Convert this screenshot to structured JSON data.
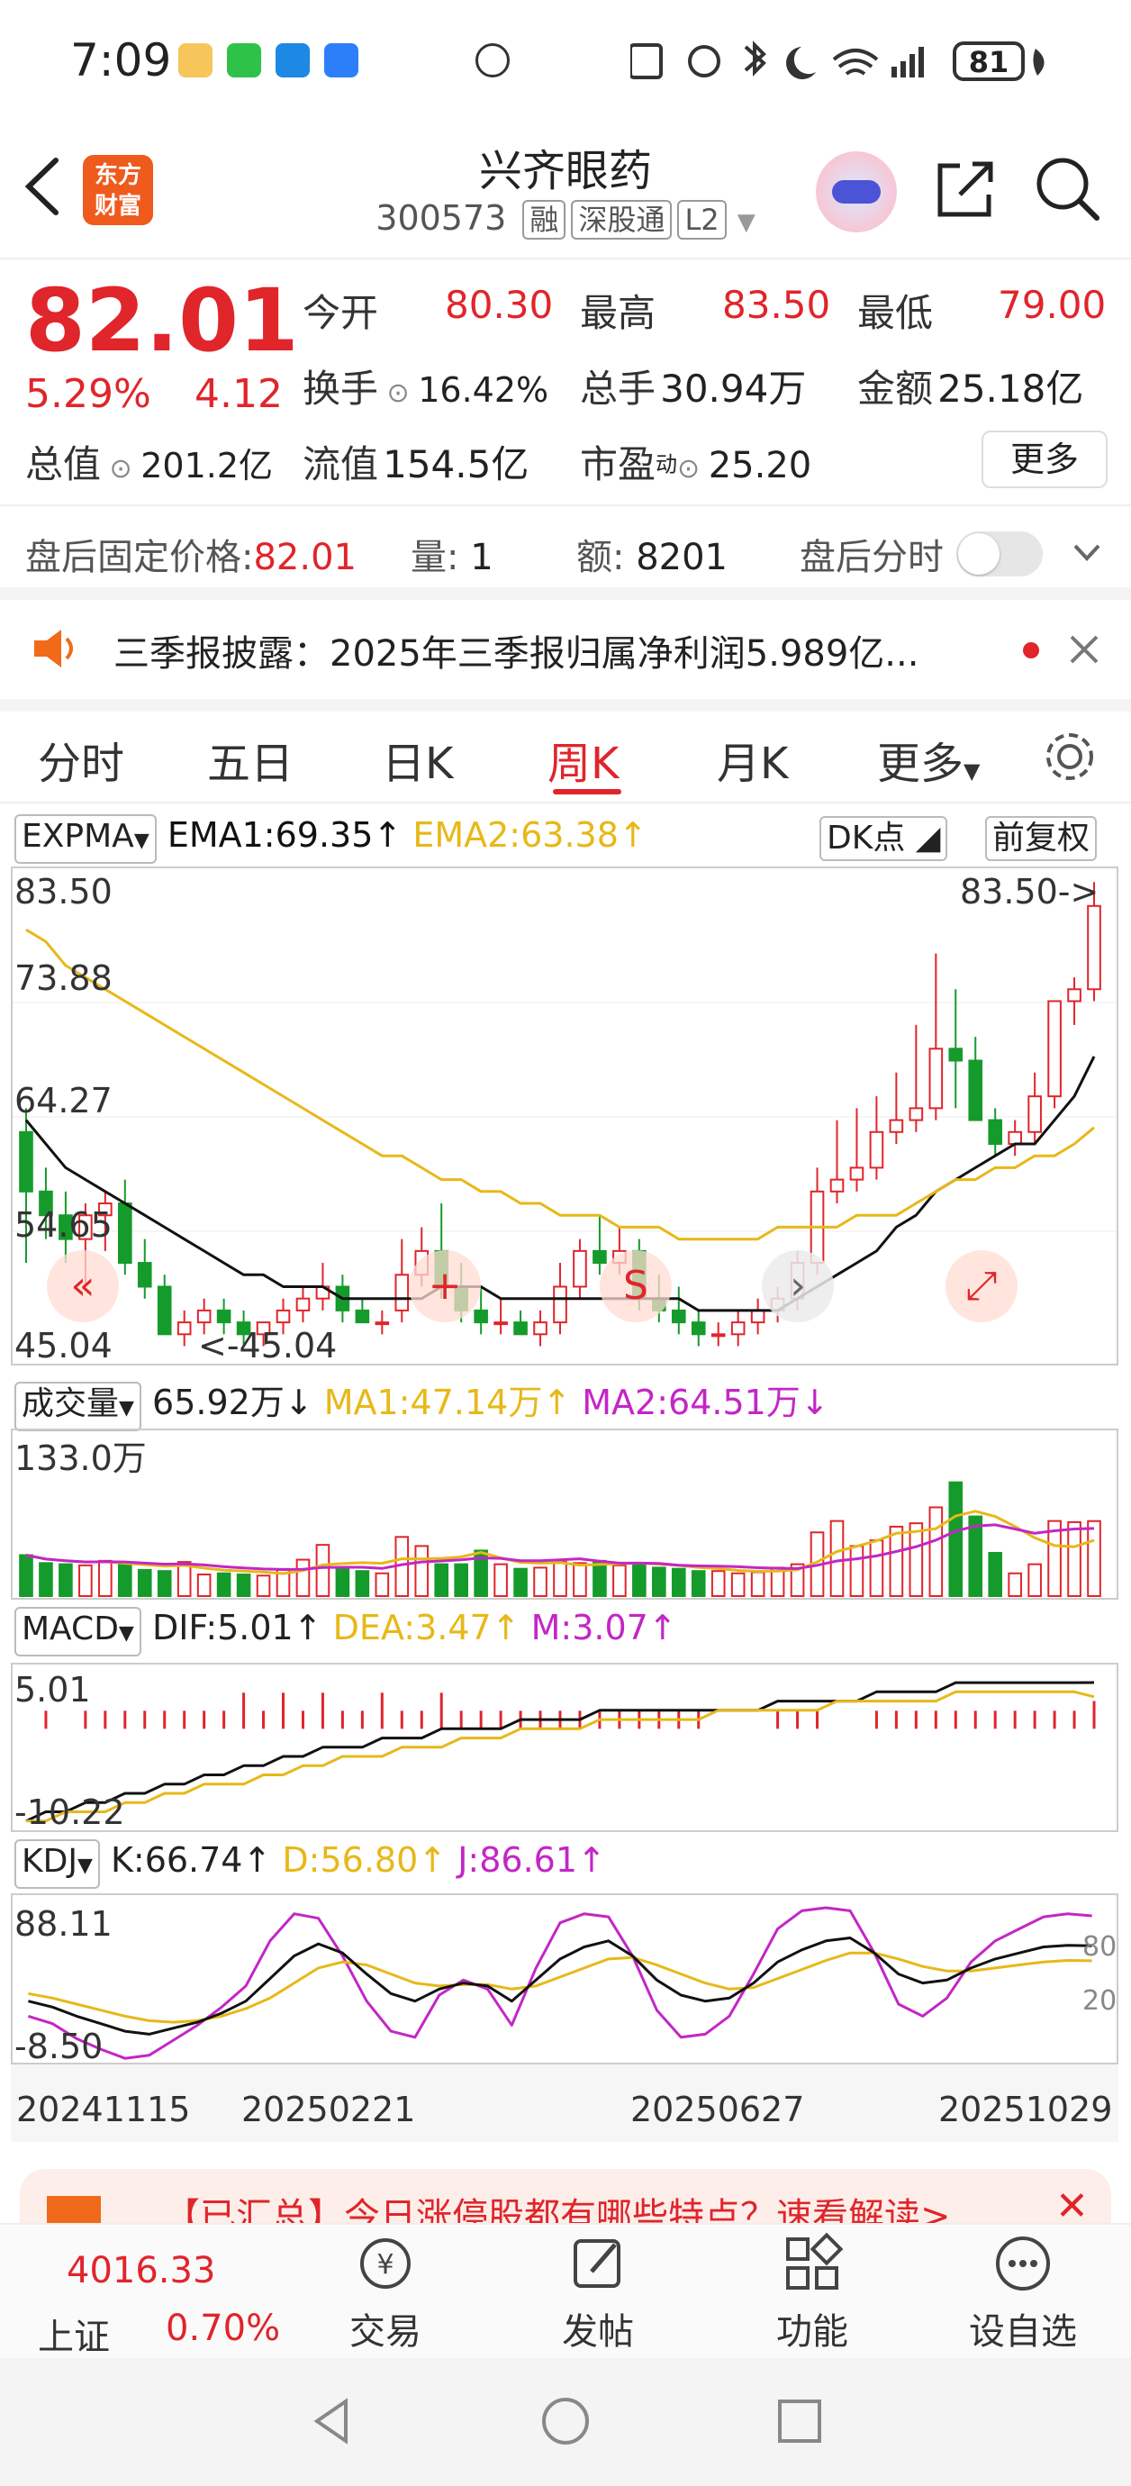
{
  "status_bar": {
    "time": "7:09",
    "battery": "81"
  },
  "header": {
    "logo_line1": "东方",
    "logo_line2": "财富",
    "stock_name": "兴齐眼药",
    "stock_code": "300573",
    "tags": [
      "融",
      "深股通",
      "L2"
    ]
  },
  "quote": {
    "price": "82.01",
    "change_pct": "5.29%",
    "change": "4.12",
    "open_label": "今开",
    "open": "80.30",
    "high_label": "最高",
    "high": "83.50",
    "low_label": "最低",
    "low": "79.00",
    "turnover_label": "换手",
    "turnover": "16.42%",
    "volume_label": "总手",
    "volume": "30.94万",
    "amount_label": "金额",
    "amount": "25.18亿",
    "mktcap_label": "总值",
    "mktcap": "201.2亿",
    "float_label": "流值",
    "float_cap": "154.5亿",
    "pe_label": "市盈",
    "pe_sup": "动",
    "pe": "25.20",
    "more_label": "更多"
  },
  "after_hours": {
    "price_label": "盘后固定价格:",
    "price": "82.01",
    "vol_label": "量:",
    "vol": "1",
    "amt_label": "额:",
    "amt": "8201",
    "toggle_label": "盘后分时"
  },
  "notice": {
    "text": "三季报披露：2025年三季报归属净利润5.989亿..."
  },
  "tabs": [
    {
      "label": "分时"
    },
    {
      "label": "五日"
    },
    {
      "label": "日K"
    },
    {
      "label": "周K"
    },
    {
      "label": "月K"
    },
    {
      "label": "更多"
    }
  ],
  "kline": {
    "indicator": "EXPMA",
    "ema1": "EMA1:69.35",
    "ema2": "EMA2:63.38",
    "dk_label": "DK点",
    "adjust_label": "前复权",
    "y_labels": [
      "83.50",
      "73.88",
      "64.27",
      "54.65",
      "45.04"
    ],
    "max_label": "83.50->",
    "min_label": "<-45.04"
  },
  "volume": {
    "indicator": "成交量",
    "val": "65.92万",
    "ma1": "MA1:47.14万",
    "ma2": "MA2:64.51万",
    "y_top": "133.0万"
  },
  "macd": {
    "indicator": "MACD",
    "dif": "DIF:5.01",
    "dea": "DEA:3.47",
    "m": "M:3.07",
    "y_top": "5.01",
    "y_bottom": "-10.22"
  },
  "kdj": {
    "indicator": "KDJ",
    "k": "K:66.74",
    "d": "D:56.80",
    "j": "J:86.61",
    "y_top": "88.11",
    "y_bottom": "-8.50",
    "lvl80": "80",
    "lvl20": "20"
  },
  "dates": [
    "20241115",
    "20250221",
    "20250627",
    "20251029"
  ],
  "promo": {
    "text": "【已汇总】今日涨停股都有哪些特点？速看解读>"
  },
  "bottom": {
    "index_value": "4016.33",
    "index_name": "上证",
    "index_change": "0.70%",
    "items": [
      {
        "label": "交易"
      },
      {
        "label": "发帖"
      },
      {
        "label": "功能"
      },
      {
        "label": "设自选"
      }
    ]
  },
  "colors": {
    "up": "#e0252b",
    "down": "#159b2b",
    "ema1": "#111111",
    "ema2": "#e7b818",
    "ma2": "#c326c6"
  },
  "chart_data": {
    "type": "candlestick",
    "period": "weekly",
    "x_labels": [
      "20241115",
      "20250221",
      "20250627",
      "20251029"
    ],
    "ylim": [
      45.04,
      83.5
    ],
    "ohlc": [
      [
        63,
        65,
        52,
        58
      ],
      [
        58,
        60,
        54,
        56
      ],
      [
        56,
        58,
        52,
        54
      ],
      [
        54,
        57,
        50,
        56
      ],
      [
        56,
        58,
        53,
        57
      ],
      [
        57,
        59,
        51,
        52
      ],
      [
        52,
        54,
        49,
        50
      ],
      [
        50,
        51,
        46,
        46
      ],
      [
        46,
        48,
        45,
        47
      ],
      [
        47,
        49,
        46,
        48
      ],
      [
        48,
        49,
        46,
        47
      ],
      [
        47,
        48,
        45,
        46
      ],
      [
        46,
        47,
        45,
        47
      ],
      [
        47,
        49,
        46,
        48
      ],
      [
        48,
        50,
        47,
        49
      ],
      [
        49,
        52,
        48,
        50
      ],
      [
        50,
        51,
        47,
        48
      ],
      [
        48,
        49,
        47,
        47
      ],
      [
        47,
        48,
        46,
        47
      ],
      [
        48,
        54,
        47,
        51
      ],
      [
        51,
        55,
        50,
        53
      ],
      [
        53,
        57,
        49,
        50
      ],
      [
        50,
        52,
        47,
        48
      ],
      [
        48,
        50,
        46,
        47
      ],
      [
        47,
        49,
        46,
        47
      ],
      [
        47,
        48,
        46,
        46
      ],
      [
        46,
        48,
        45,
        47
      ],
      [
        47,
        52,
        46,
        50
      ],
      [
        50,
        54,
        49,
        53
      ],
      [
        53,
        56,
        51,
        52
      ],
      [
        52,
        55,
        51,
        53
      ],
      [
        53,
        54,
        48,
        49
      ],
      [
        49,
        51,
        47,
        48
      ],
      [
        48,
        50,
        46,
        47
      ],
      [
        47,
        48,
        45,
        46
      ],
      [
        46,
        47,
        45,
        46
      ],
      [
        46,
        48,
        45,
        47
      ],
      [
        47,
        49,
        46,
        48
      ],
      [
        48,
        50,
        47,
        49
      ],
      [
        49,
        53,
        48,
        52
      ],
      [
        52,
        60,
        51,
        58
      ],
      [
        58,
        64,
        57,
        59
      ],
      [
        59,
        65,
        58,
        60
      ],
      [
        60,
        66,
        59,
        63
      ],
      [
        63,
        68,
        62,
        64
      ],
      [
        64,
        72,
        63,
        65
      ],
      [
        65,
        78,
        64,
        70
      ],
      [
        70,
        75,
        65,
        69
      ],
      [
        69,
        71,
        64,
        64
      ],
      [
        64,
        65,
        61,
        62
      ],
      [
        62,
        64,
        61,
        63
      ],
      [
        63,
        68,
        62,
        66
      ],
      [
        66,
        74,
        65,
        74
      ],
      [
        74,
        76,
        72,
        75
      ],
      [
        75,
        84,
        74,
        82
      ]
    ],
    "ema1": [
      64,
      62,
      60,
      59,
      58,
      57,
      56,
      55,
      54,
      53,
      52,
      51,
      51,
      50,
      50,
      50,
      49,
      49,
      49,
      49,
      49,
      50,
      50,
      50,
      49,
      49,
      49,
      49,
      49,
      49,
      49,
      49,
      49,
      49,
      48,
      48,
      48,
      48,
      48,
      49,
      50,
      51,
      52,
      53,
      55,
      56,
      58,
      59,
      60,
      61,
      62,
      62,
      64,
      66,
      69.35
    ],
    "ema2": [
      80,
      79,
      77,
      76,
      75,
      74,
      73,
      72,
      71,
      70,
      69,
      68,
      67,
      66,
      65,
      64,
      63,
      62,
      61,
      61,
      60,
      59,
      59,
      58,
      58,
      57,
      57,
      56,
      56,
      56,
      55,
      55,
      55,
      54,
      54,
      54,
      54,
      54,
      55,
      55,
      55,
      55,
      56,
      56,
      56,
      57,
      58,
      59,
      59,
      60,
      60,
      61,
      61,
      62,
      63.38
    ],
    "volume_max": 133.0,
    "volume": [
      36,
      29,
      28,
      27,
      31,
      29,
      23,
      22,
      30,
      19,
      20,
      19,
      18,
      23,
      32,
      45,
      25,
      22,
      20,
      52,
      44,
      28,
      28,
      40,
      28,
      24,
      25,
      30,
      29,
      31,
      27,
      28,
      25,
      24,
      22,
      22,
      20,
      21,
      25,
      28,
      56,
      66,
      44,
      49,
      61,
      64,
      78,
      100,
      70,
      38,
      20,
      28,
      66,
      65,
      65.92
    ],
    "macd": {
      "dif": [
        -10,
        -9,
        -9,
        -8,
        -8,
        -7,
        -7,
        -6,
        -6,
        -5,
        -5,
        -4,
        -4,
        -3,
        -3,
        -2,
        -2,
        -2,
        -1,
        -1,
        -1,
        0,
        0,
        0,
        0,
        1,
        1,
        1,
        1,
        2,
        2,
        2,
        2,
        2,
        2,
        2,
        2,
        2,
        3,
        3,
        3,
        3,
        3,
        4,
        4,
        4,
        4,
        5,
        5,
        5,
        5,
        5,
        5,
        5,
        5.01
      ],
      "dea": [
        -10,
        -10,
        -9,
        -9,
        -9,
        -8,
        -8,
        -7,
        -7,
        -6,
        -6,
        -6,
        -5,
        -5,
        -4,
        -4,
        -3,
        -3,
        -3,
        -2,
        -2,
        -2,
        -1,
        -1,
        -1,
        0,
        0,
        0,
        0,
        1,
        1,
        1,
        1,
        1,
        1,
        2,
        2,
        2,
        2,
        2,
        2,
        3,
        3,
        3,
        3,
        3,
        3,
        4,
        4,
        4,
        4,
        4,
        4,
        4,
        3.47
      ]
    },
    "kdj": {
      "k": [
        30,
        26,
        20,
        15,
        10,
        8,
        12,
        16,
        22,
        30,
        45,
        60,
        68,
        62,
        48,
        35,
        30,
        38,
        42,
        40,
        30,
        44,
        58,
        66,
        70,
        60,
        44,
        34,
        30,
        32,
        42,
        56,
        64,
        70,
        72,
        62,
        48,
        42,
        44,
        52,
        58,
        62,
        66,
        67,
        66.74
      ],
      "d": [
        35,
        32,
        28,
        24,
        20,
        17,
        16,
        17,
        20,
        25,
        32,
        42,
        52,
        56,
        54,
        48,
        42,
        40,
        41,
        41,
        38,
        40,
        46,
        52,
        58,
        59,
        54,
        48,
        42,
        38,
        39,
        45,
        51,
        57,
        62,
        62,
        58,
        53,
        50,
        50,
        52,
        54,
        56,
        57,
        56.8
      ],
      "j": [
        20,
        15,
        5,
        -2,
        -8,
        -6,
        4,
        14,
        26,
        40,
        70,
        88,
        85,
        60,
        30,
        10,
        6,
        34,
        44,
        38,
        14,
        52,
        82,
        88,
        86,
        60,
        24,
        6,
        8,
        20,
        48,
        78,
        90,
        92,
        90,
        62,
        28,
        20,
        32,
        56,
        70,
        78,
        86,
        88,
        86.61
      ]
    }
  }
}
